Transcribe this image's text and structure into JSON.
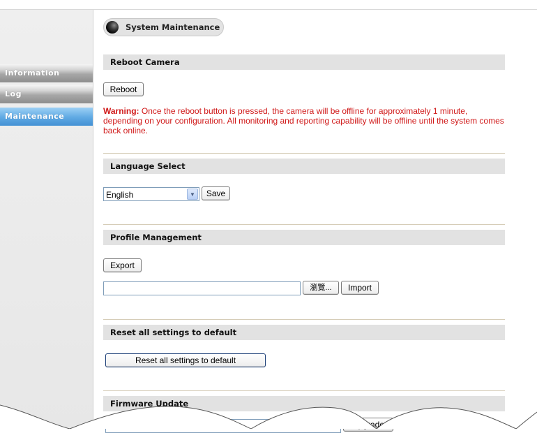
{
  "sidebar": {
    "items": [
      {
        "label": "Information"
      },
      {
        "label": "Log"
      },
      {
        "label": "Maintenance"
      }
    ]
  },
  "page": {
    "title": "System Maintenance"
  },
  "sections": {
    "reboot": {
      "header": "Reboot Camera",
      "button": "Reboot",
      "warning_label": "Warning:",
      "warning_text": " Once the reboot button is pressed, the camera will be offline for approximately 1 minute, depending on your configuration. All monitoring and reporting capability will be offline until the system comes back online."
    },
    "language": {
      "header": "Language Select",
      "selected": "English",
      "save_button": "Save"
    },
    "profile": {
      "header": "Profile Management",
      "export_button": "Export",
      "file_value": "",
      "browse_button": "瀏覽...",
      "import_button": "Import"
    },
    "reset": {
      "header": "Reset all settings to default",
      "button": "Reset all settings to default"
    },
    "firmware": {
      "header": "Firmware Update",
      "file_value": "",
      "upgrade_button": "Upgrade"
    }
  },
  "colors": {
    "warning": "#d01818",
    "nav_active": "#4391d4",
    "section_bar": "#e2e2e2"
  },
  "icons": {
    "title_bullet": "dark-sphere-icon"
  }
}
